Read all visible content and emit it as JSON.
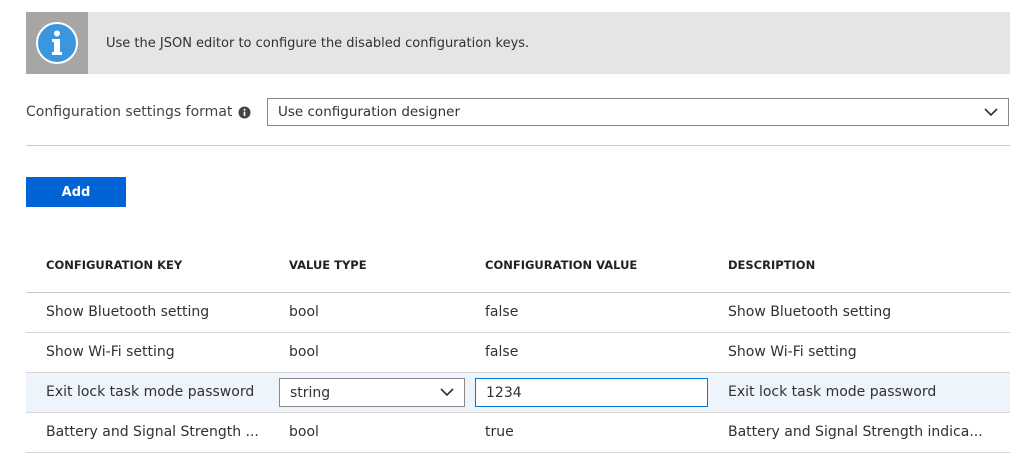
{
  "banner": {
    "icon": "info-icon",
    "message": "Use the JSON editor to configure the disabled configuration keys."
  },
  "format": {
    "label": "Configuration settings format",
    "info_icon": "info-circle-icon",
    "selected": "Use configuration designer"
  },
  "actions": {
    "add_label": "Add"
  },
  "table": {
    "headers": [
      "CONFIGURATION KEY",
      "VALUE TYPE",
      "CONFIGURATION VALUE",
      "DESCRIPTION"
    ],
    "rows": [
      {
        "key": "Show Bluetooth setting",
        "type": "bool",
        "value": "false",
        "description": "Show Bluetooth setting"
      },
      {
        "key": "Show Wi-Fi setting",
        "type": "bool",
        "value": "false",
        "description": "Show Wi-Fi setting"
      },
      {
        "key": "Exit lock task mode password",
        "type": "string",
        "value": "1234",
        "description": "Exit lock task mode password"
      },
      {
        "key": "Battery and Signal Strength ...",
        "type": "bool",
        "value": "true",
        "description": "Battery and Signal Strength indica..."
      }
    ]
  },
  "colors": {
    "accent": "#0063d6",
    "banner_bg": "#e5e5e5",
    "icon_blue": "#3a96dd"
  }
}
